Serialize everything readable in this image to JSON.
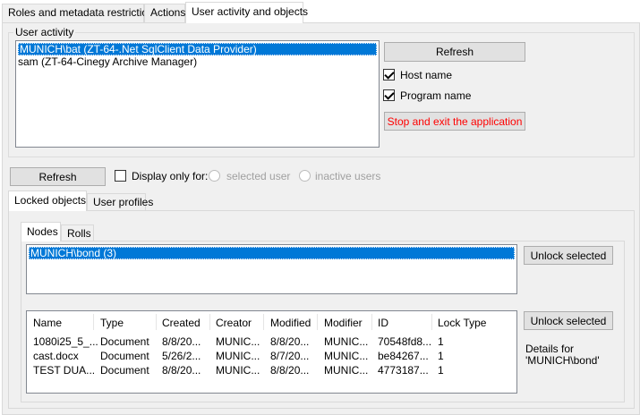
{
  "top_tabs": [
    {
      "label": "Roles and metadata restrictions"
    },
    {
      "label": "Actions"
    },
    {
      "label": "User activity and objects"
    }
  ],
  "user_activity": {
    "title": "User activity",
    "items": [
      "MUNICH\\bat (ZT-64-.Net SqlClient Data Provider)",
      "sam (ZT-64-Cinegy Archive Manager)"
    ],
    "refresh_label": "Refresh",
    "host_name_label": "Host name",
    "host_name_checked": true,
    "program_name_label": "Program name",
    "program_name_checked": true,
    "stop_exit_label": "Stop and exit the application",
    "stop_exit_color": "#ff0000"
  },
  "objects": {
    "refresh_label": "Refresh",
    "display_only_label": "Display only for:",
    "selected_user_label": "selected user",
    "inactive_users_label": "inactive users",
    "tabs": [
      {
        "label": "Locked objects"
      },
      {
        "label": "User profiles"
      }
    ],
    "inner_tabs": [
      {
        "label": "Nodes"
      },
      {
        "label": "Rolls"
      }
    ],
    "nodes_items": [
      "MUNICH\\bond (3)"
    ],
    "unlock_selected_label": "Unlock selected",
    "unlock_selected_label_2": "Unlock selected",
    "details_line1": "Details for",
    "details_line2": "'MUNICH\\bond'",
    "table": {
      "columns": [
        "Name",
        "Type",
        "Created",
        "Creator",
        "Modified",
        "Modifier",
        "ID",
        "Lock Type"
      ],
      "rows": [
        [
          "1080i25_5_...",
          "Document",
          "8/8/20...",
          "MUNIC...",
          "8/8/20...",
          "MUNIC...",
          "70548fd8...",
          "1"
        ],
        [
          "cast.docx",
          "Document",
          "5/26/2...",
          "MUNIC...",
          "8/7/20...",
          "MUNIC...",
          "be84267...",
          "1"
        ],
        [
          "TEST DUA...",
          "Document",
          "8/8/20...",
          "MUNIC...",
          "8/8/20...",
          "MUNIC...",
          "4773187...",
          "1"
        ]
      ]
    }
  },
  "colors": {
    "selection": "#0078d7",
    "panel_bg": "#f0f0f0",
    "button_bg": "#e1e1e1"
  }
}
